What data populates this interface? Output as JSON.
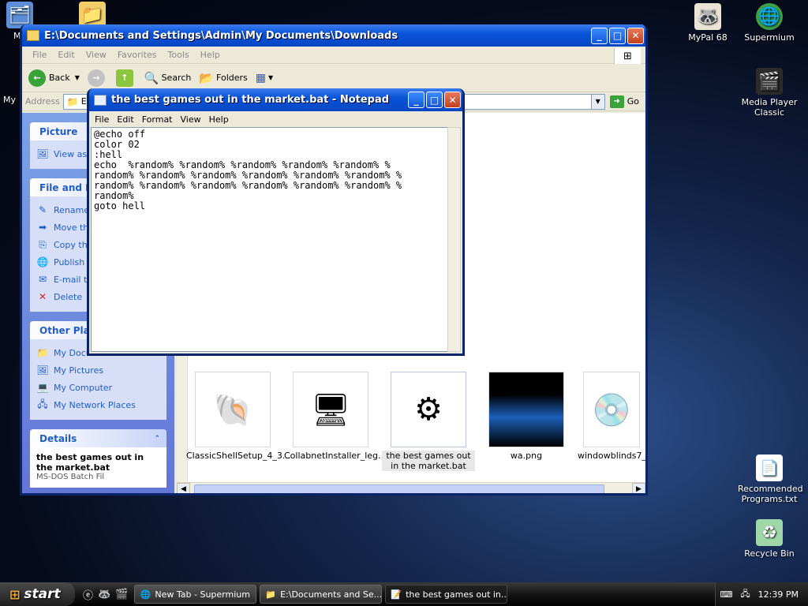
{
  "desktop": {
    "icons": [
      {
        "label": "My",
        "icon": "my-documents-icon"
      },
      {
        "label": "My",
        "icon": "my-computer-icon"
      },
      {
        "label": "MyPal 68",
        "icon": "mypal-icon"
      },
      {
        "label": "Supermium",
        "icon": "supermium-icon"
      },
      {
        "label": "Media Player Classic",
        "icon": "media-player-classic-icon"
      },
      {
        "label": "Recommended Programs.txt",
        "icon": "text-file-icon"
      },
      {
        "label": "Recycle Bin",
        "icon": "recycle-bin-icon"
      }
    ]
  },
  "explorer": {
    "title": "E:\\Documents and Settings\\Admin\\My Documents\\Downloads",
    "menu": [
      "File",
      "Edit",
      "View",
      "Favorites",
      "Tools",
      "Help"
    ],
    "toolbar": {
      "back": "Back",
      "search": "Search",
      "folders": "Folders"
    },
    "address": {
      "label": "Address",
      "value": "E:",
      "go": "Go"
    },
    "tasks_panels": [
      {
        "title": "Picture",
        "links": [
          "View as"
        ]
      },
      {
        "title": "File and Fo",
        "links": [
          "Rename",
          "Move th",
          "Copy th",
          "Publish Web",
          "E-mail t",
          "Delete"
        ]
      },
      {
        "title": "Other Plac",
        "links": [
          "My Documents",
          "My Pictures",
          "My Computer",
          "My Network Places"
        ]
      },
      {
        "title": "Details",
        "details_name": "the best games out in the market.bat",
        "details_type": "MS-DOS Batch Fil"
      }
    ],
    "files": [
      {
        "name": "ClassicShellSetup_4_3...",
        "icon": "shell-icon"
      },
      {
        "name": "CollabnetInstaller_leg...",
        "icon": "installer-icon"
      },
      {
        "name": "the best games out in the market.bat",
        "icon": "batch-file-icon"
      },
      {
        "name": "wa.png",
        "icon": "image-file-icon"
      },
      {
        "name": "windowblinds7_pu",
        "icon": "setup-icon"
      }
    ]
  },
  "notepad": {
    "title": "the best games out in the market.bat - Notepad",
    "menu": [
      "File",
      "Edit",
      "Format",
      "View",
      "Help"
    ],
    "content": "@echo off\ncolor 02\n:hell\necho  %random% %random% %random% %random% %random% %\nrandom% %random% %random% %random% %random% %random% %\nrandom% %random% %random% %random% %random% %random% %\nrandom%\ngoto hell"
  },
  "taskbar": {
    "start": "start",
    "tasks": [
      {
        "label": "New Tab - Supermium",
        "icon": "supermium-icon"
      },
      {
        "label": "E:\\Documents and Se...",
        "icon": "folder-icon"
      },
      {
        "label": "the best games out in...",
        "icon": "notepad-icon"
      }
    ],
    "clock": "12:39 PM"
  }
}
